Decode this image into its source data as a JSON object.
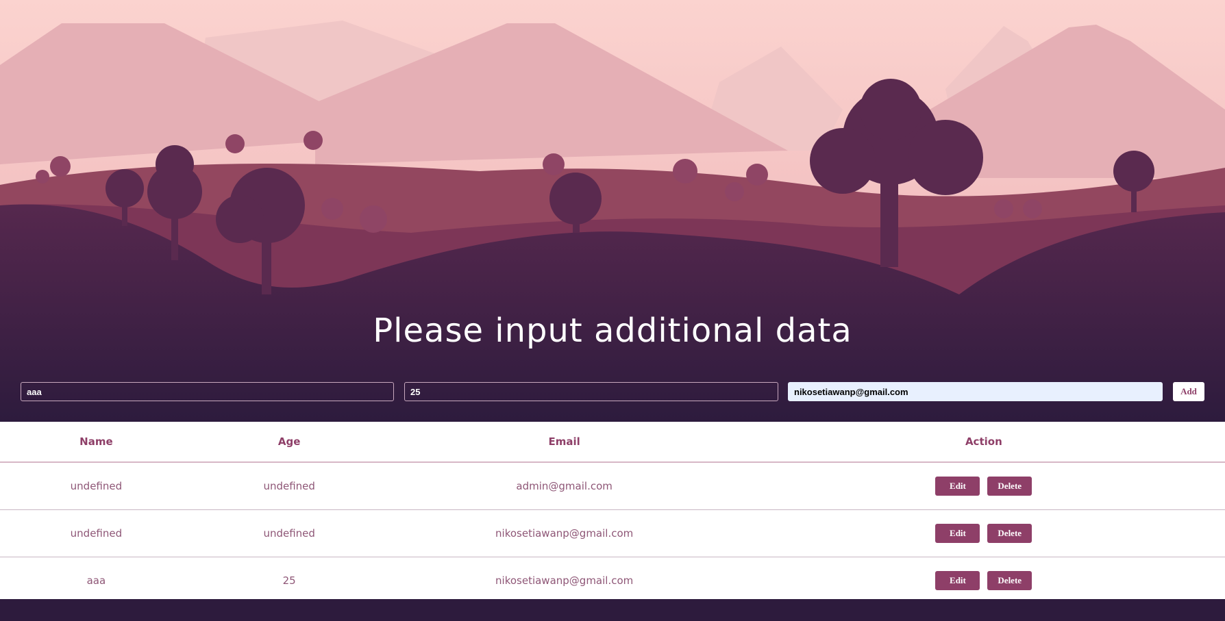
{
  "page": {
    "title": "Please input additional data"
  },
  "form": {
    "name_value": "aaa",
    "age_value": "25",
    "email_value": "nikosetiawanp@gmail.com",
    "add_label": "Add"
  },
  "table": {
    "headers": {
      "name": "Name",
      "age": "Age",
      "email": "Email",
      "action": "Action"
    },
    "rows": [
      {
        "name": "undefined",
        "age": "undefined",
        "email": "admin@gmail.com",
        "edit": "Edit",
        "delete": "Delete"
      },
      {
        "name": "undefined",
        "age": "undefined",
        "email": "nikosetiawanp@gmail.com",
        "edit": "Edit",
        "delete": "Delete"
      },
      {
        "name": "aaa",
        "age": "25",
        "email": "nikosetiawanp@gmail.com",
        "edit": "Edit",
        "delete": "Delete"
      }
    ]
  },
  "colors": {
    "accent": "#8e3f68",
    "background_dark": "#2d1b3d",
    "sky": "#fbd3cf"
  }
}
